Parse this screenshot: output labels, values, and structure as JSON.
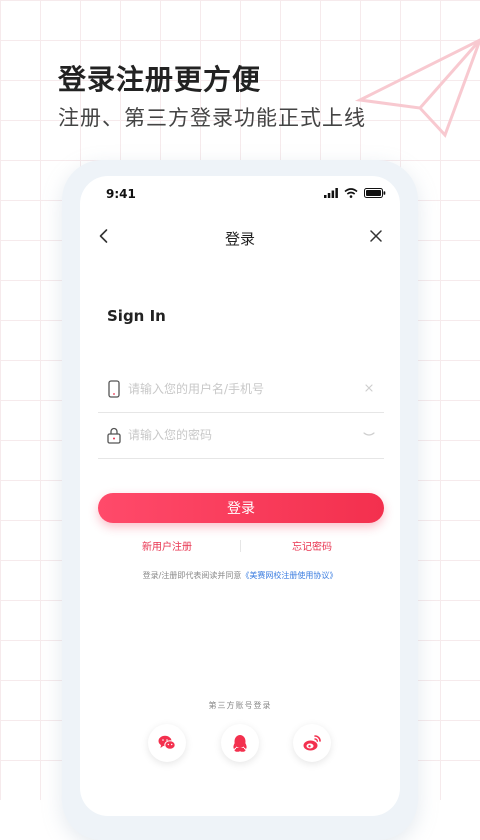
{
  "hero": {
    "title": "登录注册更方便",
    "subtitle": "注册、第三方登录功能正式上线"
  },
  "status_bar": {
    "time": "9:41"
  },
  "nav": {
    "title": "登录"
  },
  "form": {
    "heading": "Sign In",
    "username_placeholder": "请输入您的用户名/手机号",
    "password_placeholder": "请输入您的密码",
    "login_label": "登录"
  },
  "links": {
    "register": "新用户注册",
    "forgot": "忘记密码"
  },
  "agreement": {
    "prefix": "登录/注册即代表阅读并同意",
    "link": "《美赛网校注册使用协议》"
  },
  "third_party": {
    "label": "第三方账号登录",
    "providers": [
      "wechat-icon",
      "qq-icon",
      "weibo-icon"
    ]
  },
  "colors": {
    "accent": "#f3304e",
    "link_blue": "#3b7de0"
  }
}
